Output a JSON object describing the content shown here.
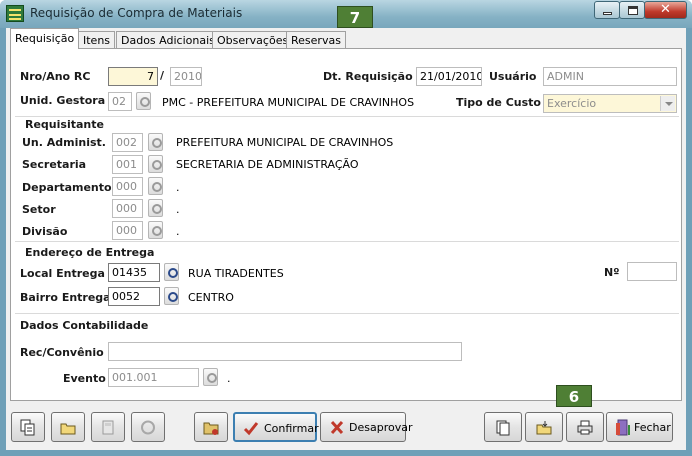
{
  "window": {
    "title": "Requisição de Compra de Materiais"
  },
  "tabs": [
    "Requisição",
    "Itens",
    "Dados Adicionais",
    "Observações",
    "Reservas"
  ],
  "header": {
    "nro_ano_label": "Nro/Ano RC",
    "nro": "7",
    "slash": "/",
    "ano": "2010",
    "dt_label": "Dt. Requisição",
    "dt_value": "21/01/2010",
    "usuario_label": "Usuário",
    "usuario_value": "ADMIN",
    "unid_label": "Unid. Gestora",
    "unid_code": "02",
    "unid_name": "PMC - PREFEITURA MUNICIPAL DE CRAVINHOS",
    "tipo_label": "Tipo de Custo",
    "tipo_value": "Exercício"
  },
  "requisitante": {
    "title": "Requisitante",
    "un_label": "Un. Administ.",
    "un_code": "002",
    "un_name": "PREFEITURA MUNICIPAL DE CRAVINHOS",
    "sec_label": "Secretaria",
    "sec_code": "001",
    "sec_name": "SECRETARIA DE ADMINISTRAÇÃO",
    "dep_label": "Departamento",
    "dep_code": "000",
    "dep_name": ".",
    "setor_label": "Setor",
    "setor_code": "000",
    "setor_name": ".",
    "div_label": "Divisão",
    "div_code": "000",
    "div_name": "."
  },
  "endereco": {
    "title": "Endereço de Entrega",
    "local_label": "Local Entrega",
    "local_code": "01435",
    "local_name": "RUA  TIRADENTES",
    "numero_label": "Nº",
    "numero_value": "",
    "bairro_label": "Bairro Entrega",
    "bairro_code": "0052",
    "bairro_name": "CENTRO"
  },
  "contabilidade": {
    "title": "Dados Contabilidade",
    "rec_label": "Rec/Convênio",
    "rec_value": "",
    "evento_label": "Evento",
    "evento_value": "001.001",
    "evento_name": "."
  },
  "toolbar": {
    "confirmar": "Confirmar",
    "desaprovar": "Desaprovar",
    "fechar": "Fechar"
  },
  "annotations": {
    "badge_7": "7",
    "badge_6": "6"
  }
}
